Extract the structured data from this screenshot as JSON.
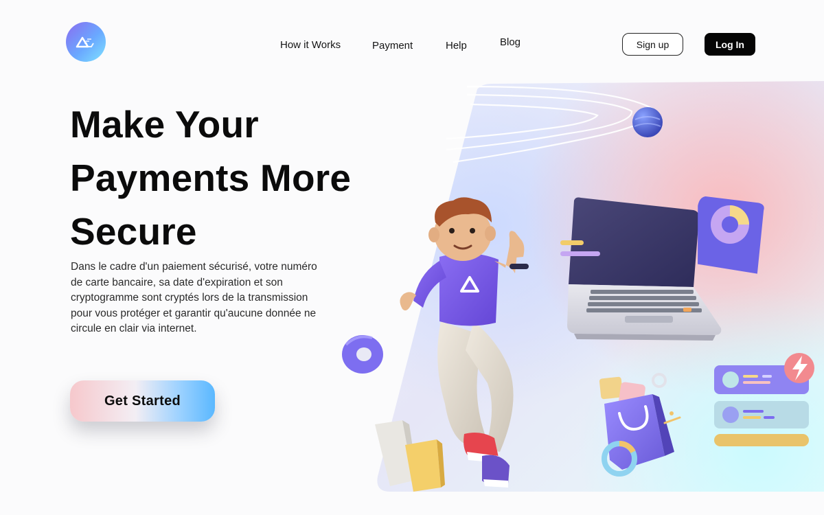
{
  "nav": {
    "links": [
      "How it Works",
      "Payment",
      "Help",
      "Blog"
    ],
    "signup_label": "Sign up",
    "login_label": "Log In"
  },
  "hero": {
    "title_lines": [
      "Make Your",
      "Payments More",
      "Secure"
    ],
    "description": "Dans le cadre d'un paiement sécurisé, votre numéro de carte bancaire, sa date d'expiration et son cryptogramme sont cryptés lors de la transmission pour vous protéger et garantir qu'aucune donnée ne circule en clair via internet.",
    "cta_label": "Get Started",
    "person_logo": "Λ"
  },
  "icons": {
    "logo": "brand-logo-icon",
    "person": "person-3d-icon",
    "laptop": "laptop-icon",
    "pie_chart": "pie-chart-icon",
    "shopping_bag": "shopping-bag-icon",
    "lightning": "lightning-icon",
    "donut": "donut-icon",
    "sphere": "sphere-icon"
  },
  "colors": {
    "accent_purple": "#7c6cf0",
    "accent_blue": "#5ab8ff",
    "accent_pink": "#f6c8cc",
    "dark": "#050505"
  }
}
